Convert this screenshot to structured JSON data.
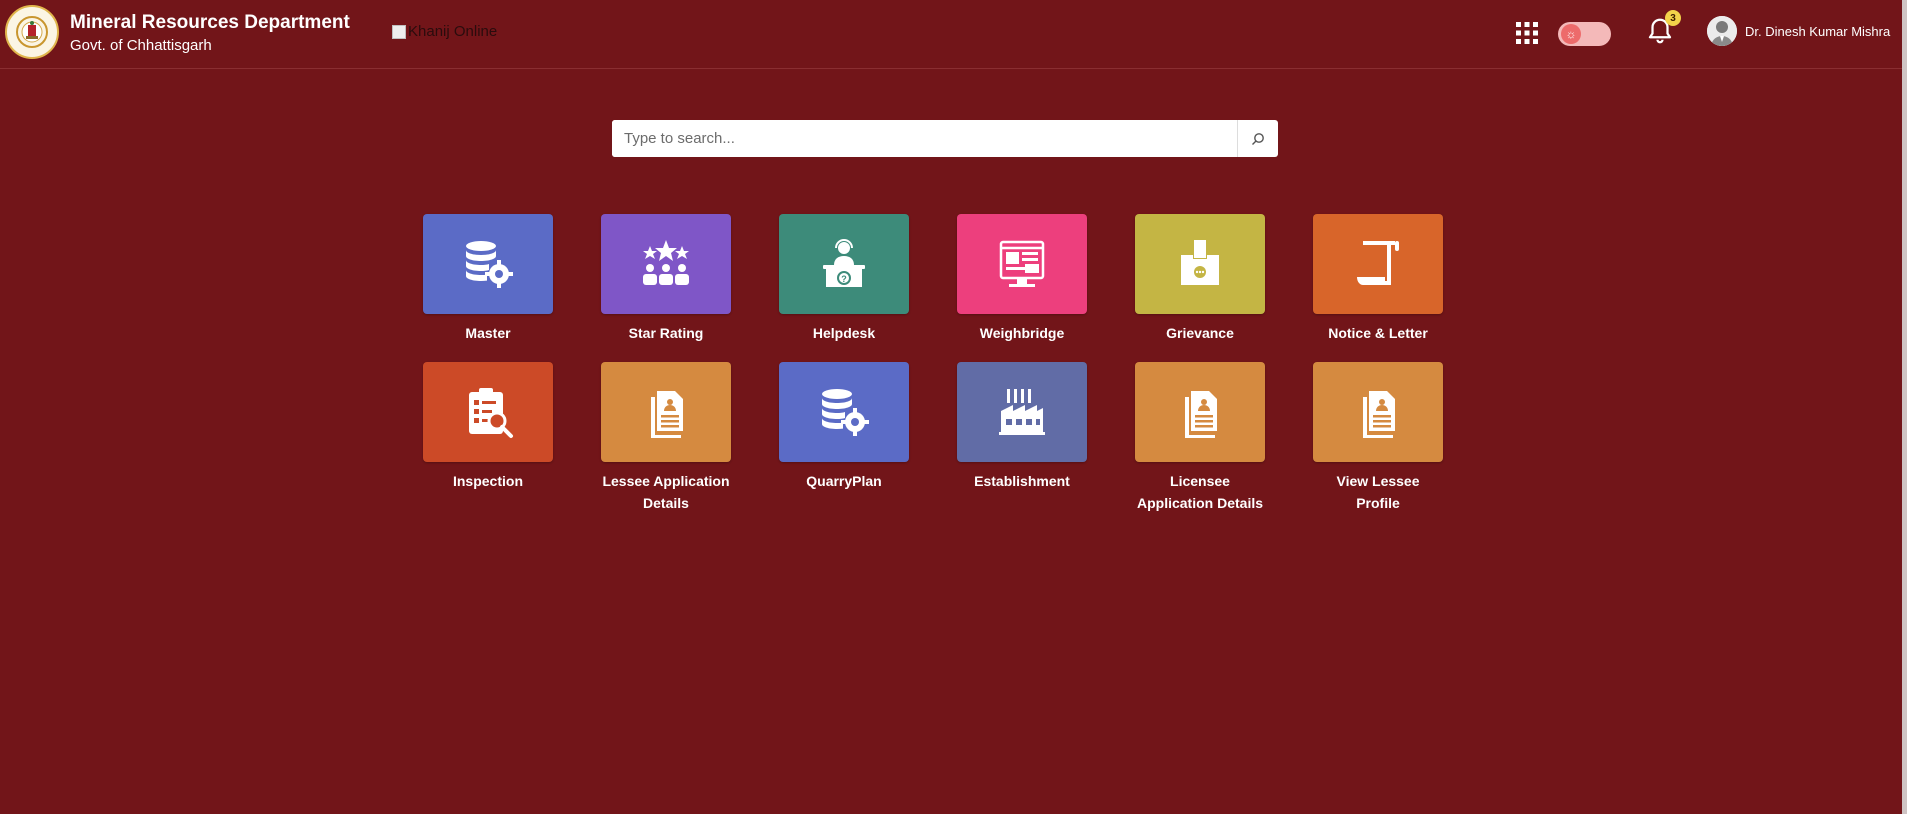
{
  "header": {
    "title": "Mineral Resources Department",
    "subtitle": "Govt. of Chhattisgarh",
    "logo_alt": "Khanij Online",
    "notification_count": "3",
    "user_name": "Dr. Dinesh Kumar Mishra",
    "theme_toggle_icon": "sun-icon"
  },
  "search": {
    "placeholder": "Type to search..."
  },
  "tiles": [
    {
      "label": "Master",
      "color": "#5b6bc6",
      "icon": "database-gear-icon"
    },
    {
      "label": "Star Rating",
      "color": "#7f56c7",
      "icon": "star-rating-icon"
    },
    {
      "label": "Helpdesk",
      "color": "#3d8b7a",
      "icon": "helpdesk-icon"
    },
    {
      "label": "Weighbridge",
      "color": "#ed3f7d",
      "icon": "weighbridge-icon"
    },
    {
      "label": "Grievance",
      "color": "#c4b544",
      "icon": "grievance-box-icon"
    },
    {
      "label": "Notice & Letter",
      "color": "#d8652a",
      "icon": "notice-scroll-icon"
    },
    {
      "label": "Inspection",
      "color": "#cc4a27",
      "icon": "inspection-clipboard-icon"
    },
    {
      "label": "Lessee Application Details",
      "color": "#d58a40",
      "icon": "document-user-icon"
    },
    {
      "label": "QuarryPlan",
      "color": "#5b6bc6",
      "icon": "database-gear-icon"
    },
    {
      "label": "Establishment",
      "color": "#616ca6",
      "icon": "factory-icon"
    },
    {
      "label": "Licensee Application Details",
      "color": "#d58a40",
      "icon": "document-user-icon"
    },
    {
      "label": "View Lessee Profile",
      "color": "#d58a40",
      "icon": "document-user-icon"
    }
  ]
}
